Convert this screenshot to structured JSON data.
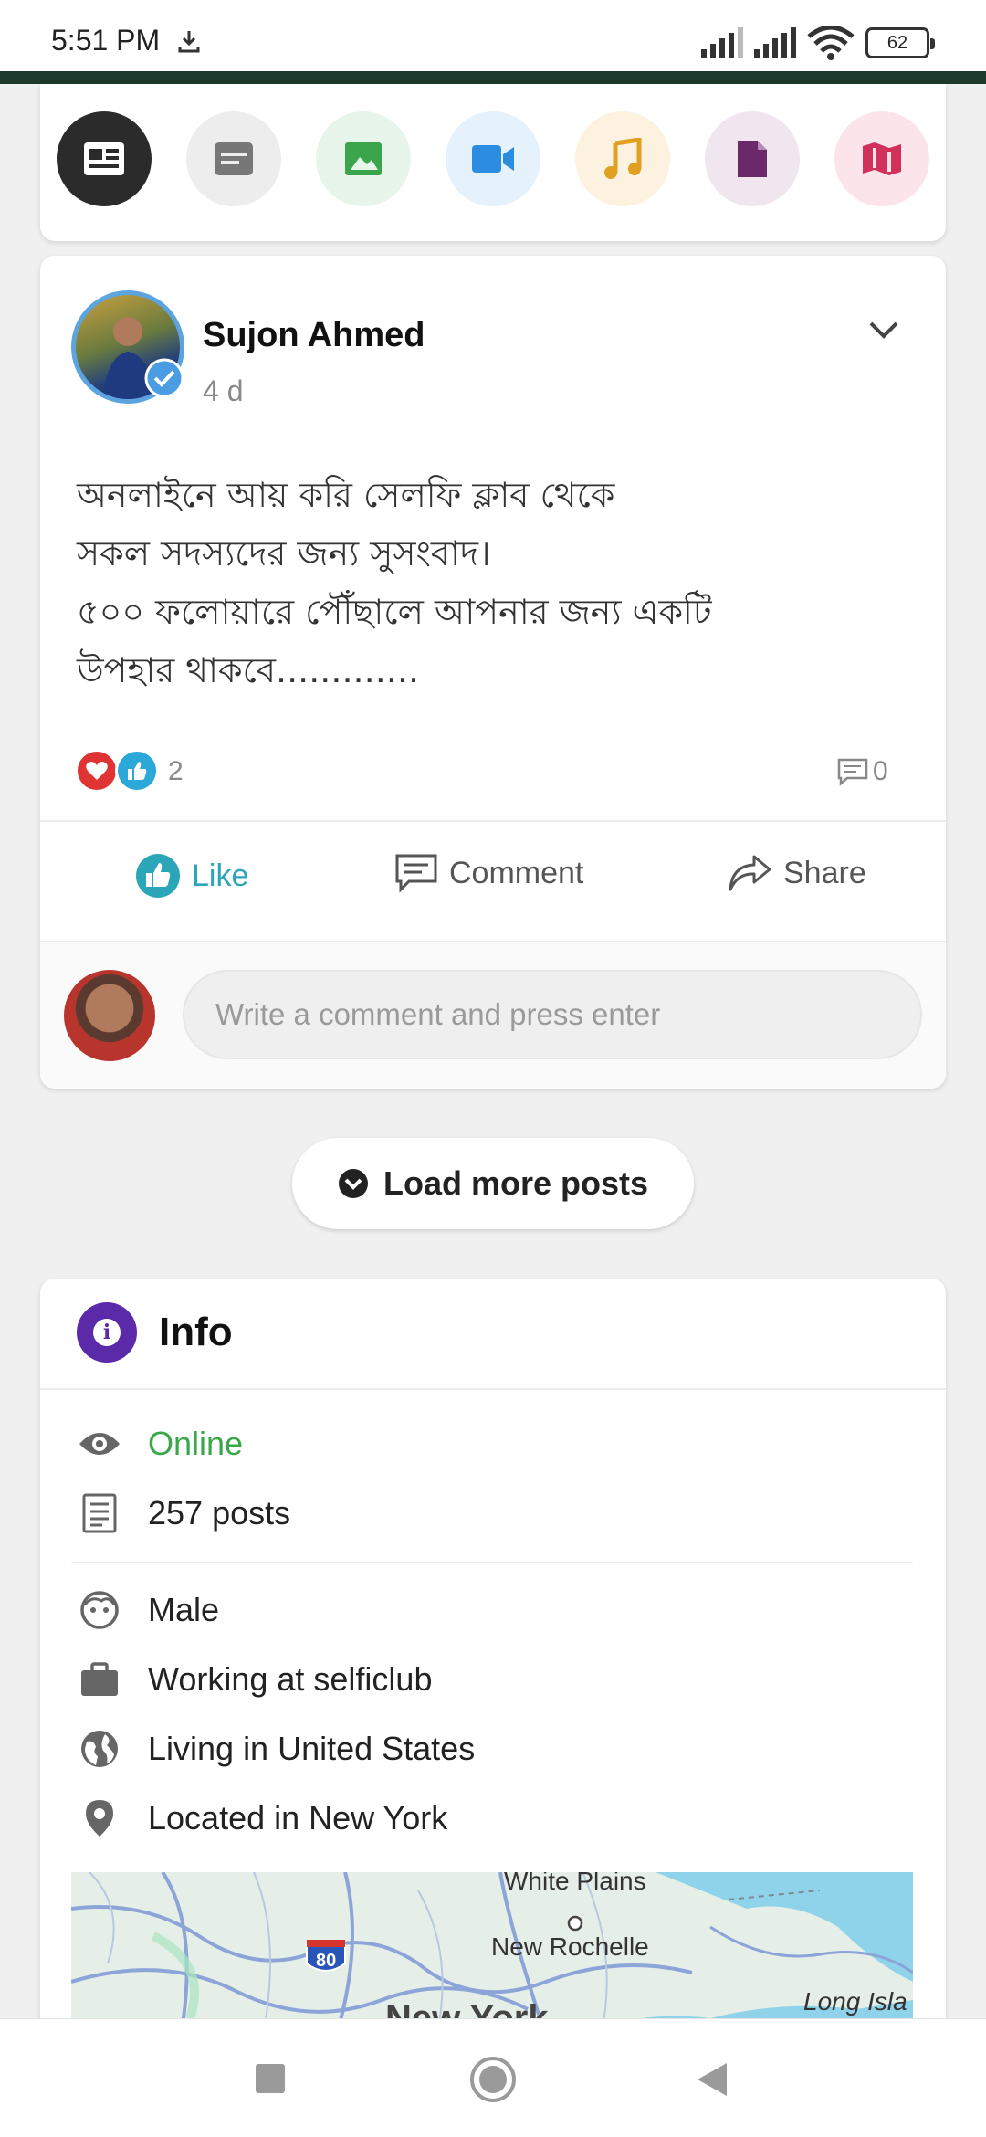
{
  "status_bar": {
    "time": "5:51 PM",
    "battery": "62"
  },
  "post_types": [
    {
      "name": "news",
      "bg": "#2b2b2b",
      "fg": "#ffffff"
    },
    {
      "name": "text",
      "bg": "#ededed",
      "fg": "#777777"
    },
    {
      "name": "photo",
      "bg": "#e8f5ea",
      "fg": "#3aa54a"
    },
    {
      "name": "video",
      "bg": "#e5f1fb",
      "fg": "#2a8de0"
    },
    {
      "name": "audio",
      "bg": "#fdf1e0",
      "fg": "#e0a020"
    },
    {
      "name": "file",
      "bg": "#efe6ef",
      "fg": "#6a2a6a"
    },
    {
      "name": "article",
      "bg": "#fbe4ea",
      "fg": "#d0305a"
    }
  ],
  "post": {
    "author": "Sujon Ahmed",
    "time_ago": "4 d",
    "text_lines": [
      "অনলাইনে আয় করি সেলফি ক্লাব থেকে",
      "সকল সদস্যদের জন্য সুসংবাদ।",
      "৫০০ ফলোয়ারে পৌঁছালে আপনার জন্য একটি",
      "উপহার থাকবে............."
    ],
    "reactions_count": "2",
    "comments_count": "0",
    "actions": {
      "like": "Like",
      "comment": "Comment",
      "share": "Share"
    },
    "comment_placeholder": "Write a comment and press enter"
  },
  "load_more": "Load more posts",
  "info": {
    "title": "Info",
    "status": "Online",
    "posts": "257 posts",
    "gender": "Male",
    "work": "Working at selficlub",
    "living": "Living in United States",
    "located": "Located in New York",
    "map_labels": {
      "white_plains": "White Plains",
      "new_rochelle": "New Rochelle",
      "highway": "80",
      "new_york": "New York",
      "long_island": "Long Isla"
    }
  },
  "colors": {
    "accent": "#2aa6b8",
    "online": "#3aa84a",
    "info_badge": "#5a2aa8",
    "dark_strip": "#1d3a2c"
  }
}
